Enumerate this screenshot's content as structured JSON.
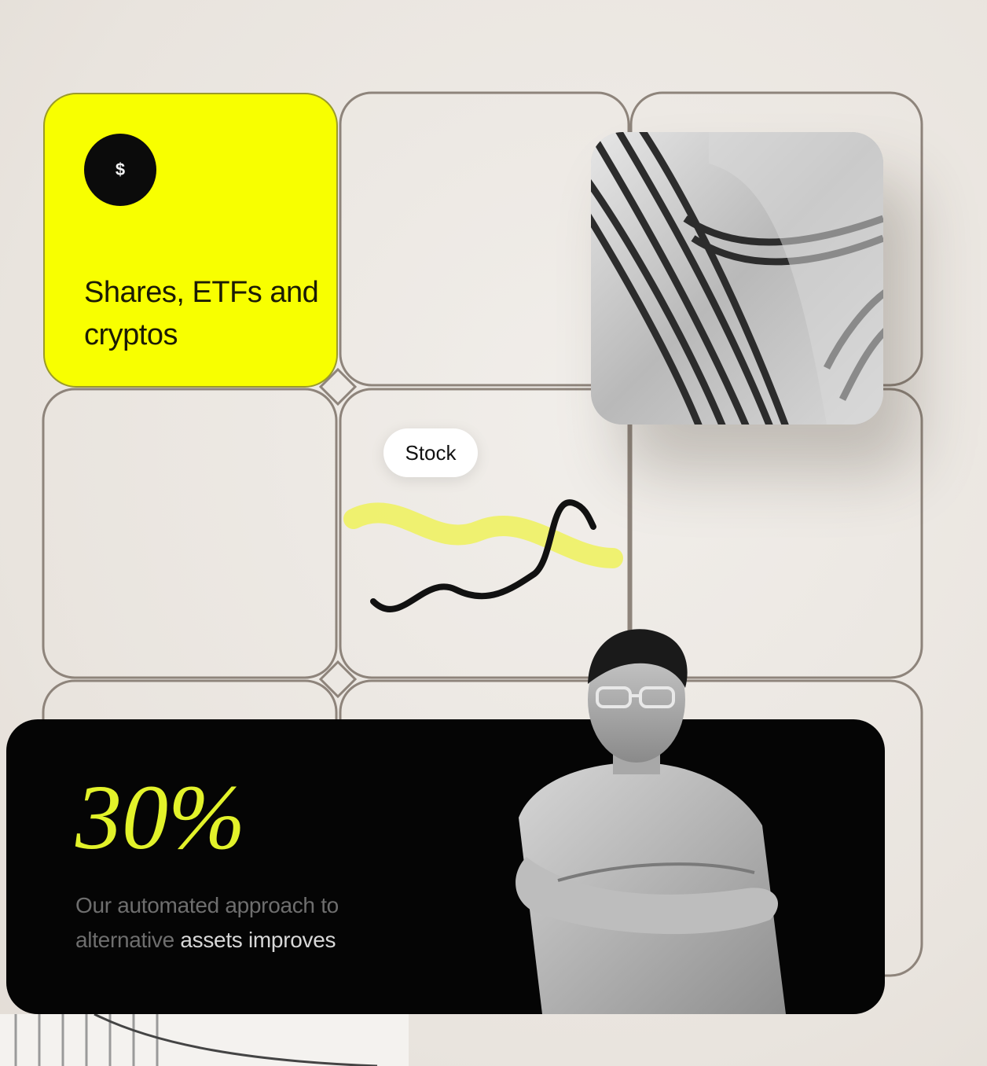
{
  "promo": {
    "asset_tile": {
      "coin_glyph": "$",
      "title": "Shares, ETFs and cryptos"
    },
    "tag_pill": {
      "label": "Stock"
    },
    "stat_card": {
      "value": "30%",
      "description_prefix": "Our automated approach to alternative",
      "description_highlight": "assets improves"
    },
    "colors": {
      "accent_yellow": "#f8ff00",
      "stat_yellow": "#e2f22a",
      "card_black": "#050505"
    },
    "icons": {
      "coin": "dollar-coin-icon",
      "squiggle": "wavy-line-icon"
    }
  }
}
